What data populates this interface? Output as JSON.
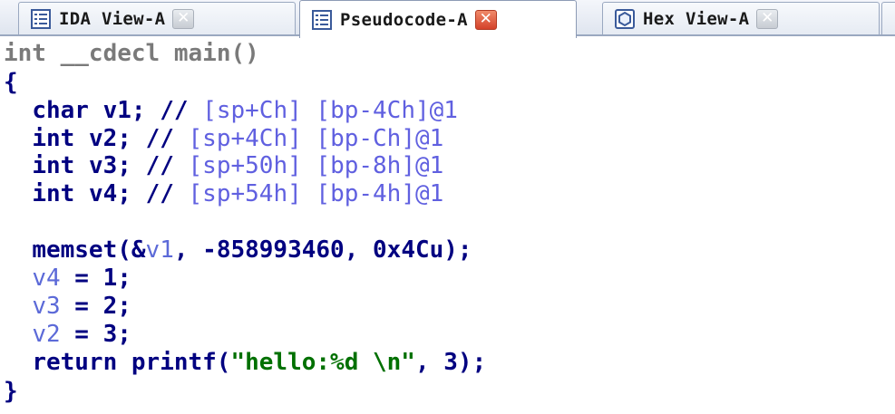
{
  "tabs": [
    {
      "label": "IDA View-A",
      "icon": "disassembly-view-icon",
      "active": false
    },
    {
      "label": "Pseudocode-A",
      "icon": "pseudocode-view-icon",
      "active": true
    },
    {
      "label": "Hex View-A",
      "icon": "hex-view-icon",
      "active": false
    }
  ],
  "code": {
    "signature": {
      "type": "int",
      "conv": "__cdecl",
      "name": "main()"
    },
    "open_brace": "{",
    "close_brace": "}",
    "decls": [
      {
        "type": "char",
        "name": "v1;",
        "comment": "//",
        "loc": "[sp+Ch] [bp-4Ch]@1"
      },
      {
        "type": "int",
        "name": "v2;",
        "comment": "//",
        "loc": "[sp+4Ch] [bp-Ch]@1"
      },
      {
        "type": "int",
        "name": "v3;",
        "comment": "//",
        "loc": "[sp+50h] [bp-8h]@1"
      },
      {
        "type": "int",
        "name": "v4;",
        "comment": "//",
        "loc": "[sp+54h] [bp-4h]@1"
      }
    ],
    "memset": {
      "fn": "memset(&",
      "var": "v1",
      "args": ", -858993460, 0x4Cu);"
    },
    "assigns": [
      {
        "var": "v4",
        "rest": " = 1;"
      },
      {
        "var": "v3",
        "rest": " = 2;"
      },
      {
        "var": "v2",
        "rest": " = 3;"
      }
    ],
    "ret": {
      "kw": "return",
      "fn": "printf(",
      "str": "\"hello:%d \\n\"",
      "tail": ", 3);"
    }
  },
  "colors": {
    "keyword": "#000080",
    "comment": "#6060e0",
    "local_var": "#5c6ad8",
    "string": "#007000",
    "active_close": "#d4422a"
  }
}
